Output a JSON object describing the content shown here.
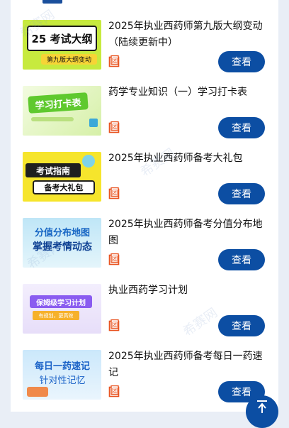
{
  "items": [
    {
      "title": "2025年执业西药师第九版大纲变动（陆续更新中）",
      "button": "查看",
      "thumb_main": "25 考试大纲",
      "thumb_sub": "第九版大纲变动"
    },
    {
      "title": "药学专业知识（一）学习打卡表",
      "button": "查看",
      "thumb_main": "学习打卡表",
      "thumb_sub": ""
    },
    {
      "title": "2025年执业西药师备考大礼包",
      "button": "查看",
      "thumb_main": "考试指南",
      "thumb_sub": "备考大礼包"
    },
    {
      "title": "2025年执业西药师备考分值分布地图",
      "button": "查看",
      "thumb_main": "分值分布地图",
      "thumb_sub": "掌握考情动态"
    },
    {
      "title": "执业西药学习计划",
      "button": "查看",
      "thumb_main": "保姆级学习计划",
      "thumb_sub": "有规划，更高效"
    },
    {
      "title": "2025年执业西药师备考每日一药速记",
      "button": "查看",
      "thumb_main": "每日一药速记",
      "thumb_sub": "针对性记忆"
    }
  ],
  "tuan_label": "团",
  "watermark": "希赛网",
  "icons": {
    "tuan": "group-buy-icon",
    "back_to_top": "arrow-up-icon"
  },
  "colors": {
    "accent": "#0c4ea3",
    "orange": "#e8521f"
  }
}
